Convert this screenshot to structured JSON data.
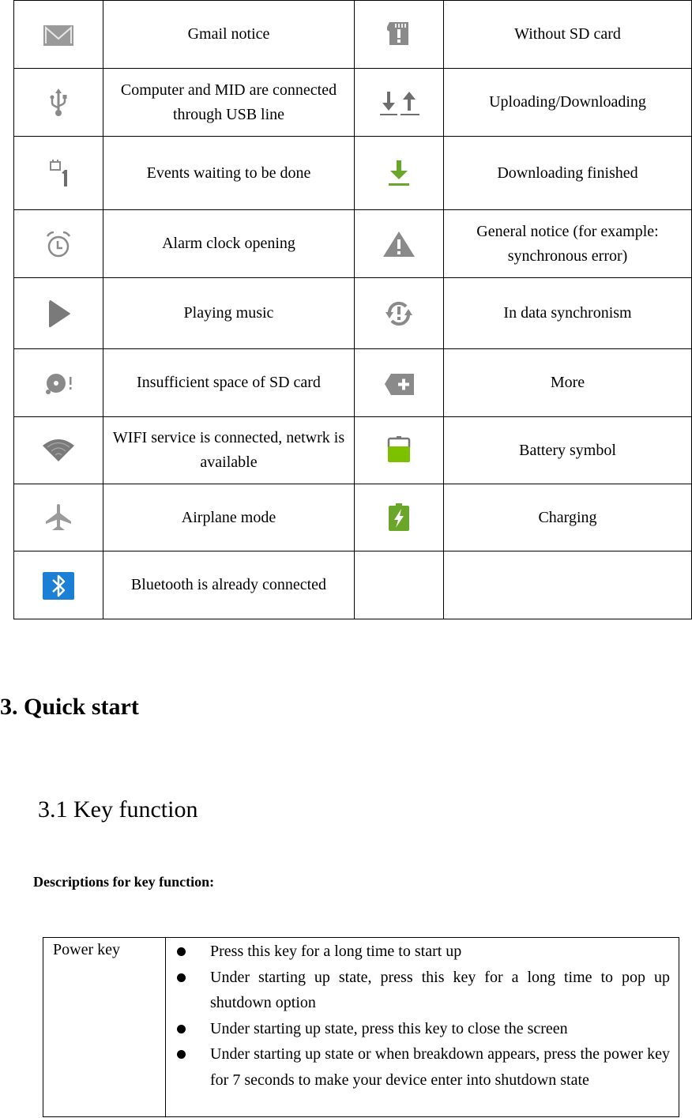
{
  "icon_table": {
    "rows": [
      {
        "left": {
          "icon": "gmail-icon",
          "label": "Gmail notice"
        },
        "right": {
          "icon": "no-sd-card-icon",
          "label": "Without SD card"
        }
      },
      {
        "left": {
          "icon": "usb-icon",
          "label": "Computer and MID are connected through USB line"
        },
        "right": {
          "icon": "upload-download-icon",
          "label": "Uploading/Downloading"
        }
      },
      {
        "left": {
          "icon": "calendar-event-icon",
          "label": "Events waiting to be done"
        },
        "right": {
          "icon": "download-finished-icon",
          "label": "Downloading finished"
        }
      },
      {
        "left": {
          "icon": "alarm-clock-icon",
          "label": "Alarm clock opening"
        },
        "right": {
          "icon": "warning-icon",
          "label": "General notice (for example: synchronous error)"
        }
      },
      {
        "left": {
          "icon": "play-icon",
          "label": "Playing music"
        },
        "right": {
          "icon": "sync-error-icon",
          "label": "In data synchronism"
        }
      },
      {
        "left": {
          "icon": "sd-card-full-icon",
          "label": "Insufficient space of SD card"
        },
        "right": {
          "icon": "more-icon",
          "label": "More"
        }
      },
      {
        "left": {
          "icon": "wifi-icon",
          "label": "WIFI service is connected, netwrk is available"
        },
        "right": {
          "icon": "battery-icon",
          "label": "Battery symbol"
        }
      },
      {
        "left": {
          "icon": "airplane-icon",
          "label": "Airplane mode"
        },
        "right": {
          "icon": "charging-icon",
          "label": "Charging"
        }
      },
      {
        "left": {
          "icon": "bluetooth-icon",
          "label": "Bluetooth is already connected"
        },
        "right": {
          "icon": "",
          "label": ""
        }
      }
    ]
  },
  "section": {
    "title": "3. Quick start",
    "subsection_title": "3.1 Key function",
    "descriptions_label": "Descriptions for key function:"
  },
  "key_table": {
    "key_name": "Power key",
    "items": [
      "Press this key for a long time to start up",
      "Under starting up state, press this key for a long time to pop up shutdown option",
      "Under starting up state, press this key to close the screen",
      "Under starting up state or when breakdown appears, press the power key for 7 seconds to make your device enter into shutdown state"
    ]
  },
  "colors": {
    "icon_gray": "#8a8a8a",
    "green": "#6aa62a",
    "battery_green": "#7cc000",
    "bluetooth_blue": "#1c7fd6"
  }
}
